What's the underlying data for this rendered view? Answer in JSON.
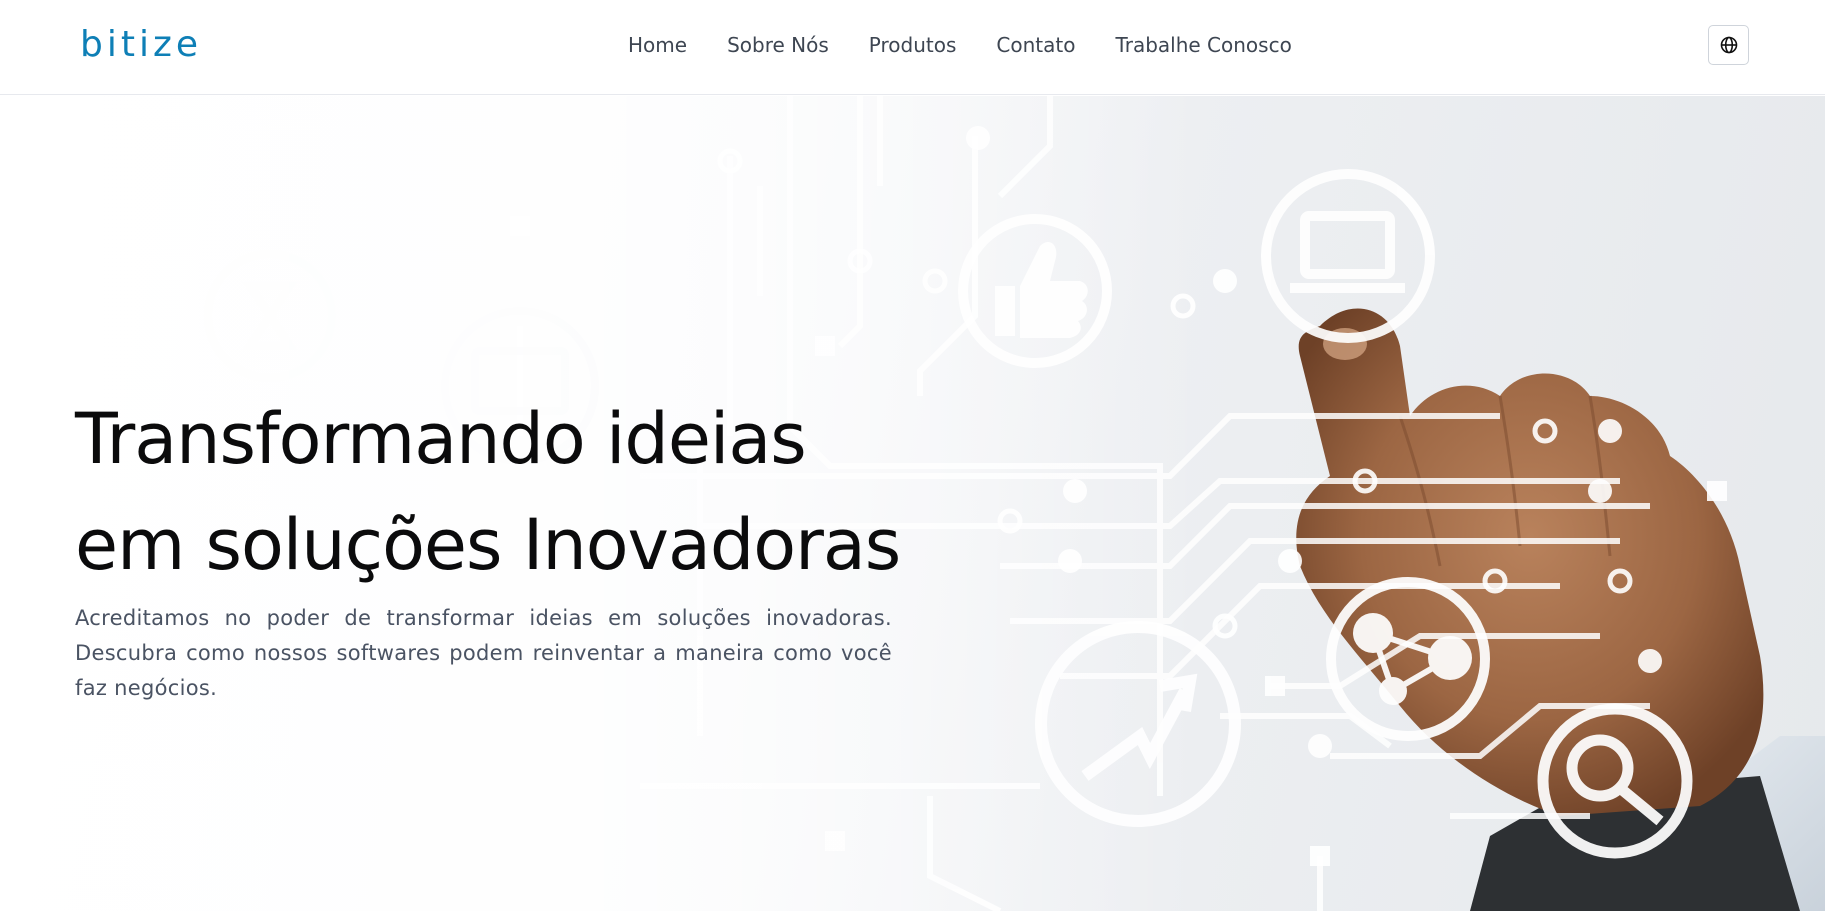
{
  "header": {
    "logo_text": "bitize",
    "nav": {
      "home": "Home",
      "about": "Sobre Nós",
      "products": "Produtos",
      "contact": "Contato",
      "careers": "Trabalhe Conosco"
    },
    "language_icon": "globe-icon"
  },
  "hero": {
    "title_line1": "Transformando ideias",
    "title_line2": "em soluções Inovadoras",
    "description": "Acreditamos no poder de transformar ideias em soluções inovadoras. Descubra como nossos softwares podem reinventar a maneira como você faz negócios.",
    "icons": [
      "hourglass-icon",
      "monitor-icon",
      "thumbs-up-icon",
      "laptop-icon",
      "trend-arrow-icon",
      "share-nodes-icon",
      "magnifier-icon"
    ]
  },
  "colors": {
    "brand": "#0e7fb6",
    "nav_text": "#3e4652",
    "title": "#0b0b0c",
    "body_text": "#4a5363"
  }
}
